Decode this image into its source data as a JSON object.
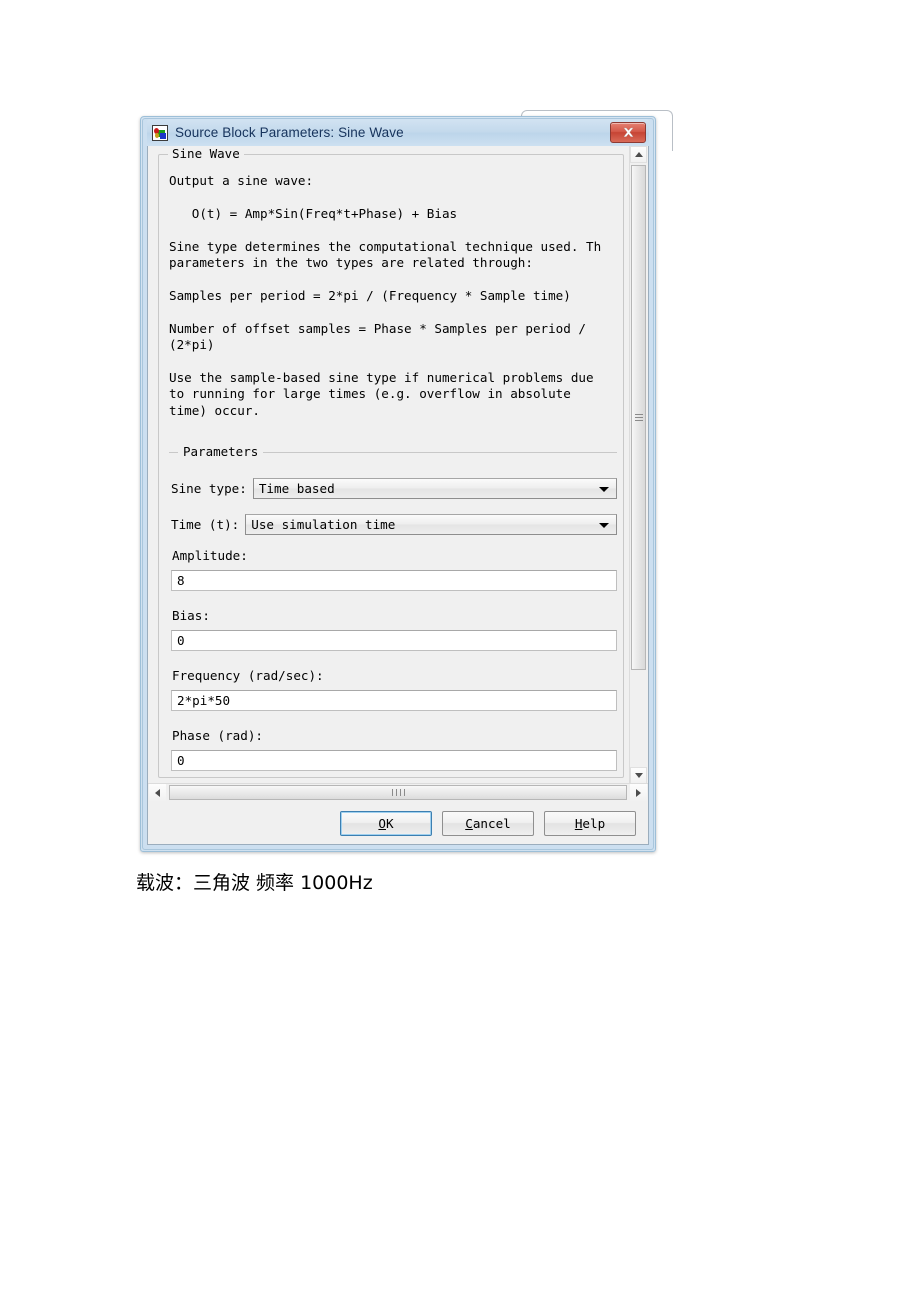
{
  "dialog": {
    "title": "Source Block Parameters: Sine Wave",
    "title_icon": "simulink-block-icon",
    "close_icon": "close-icon",
    "group_title": "Sine Wave",
    "description": "Output a sine wave:\n\n   O(t) = Amp*Sin(Freq*t+Phase) + Bias\n\nSine type determines the computational technique used. Th\nparameters in the two types are related through:\n\nSamples per period = 2*pi / (Frequency * Sample time)\n\nNumber of offset samples = Phase * Samples per period /\n(2*pi)\n\nUse the sample-based sine type if numerical problems due\nto running for large times (e.g. overflow in absolute\ntime) occur.",
    "parameters_title": "Parameters",
    "fields": {
      "sine_type_label": "Sine type:",
      "sine_type_value": "Time based",
      "time_label": "Time (t):",
      "time_value": "Use simulation time",
      "amplitude_label": "Amplitude:",
      "amplitude_value": "8",
      "bias_label": "Bias:",
      "bias_value": "0",
      "frequency_label": "Frequency (rad/sec):",
      "frequency_value": "2*pi*50",
      "phase_label": "Phase (rad):",
      "phase_value": "0"
    },
    "buttons": {
      "ok_pre": "",
      "ok_mnemonic": "O",
      "ok_post": "K",
      "cancel_pre": "",
      "cancel_mnemonic": "C",
      "cancel_post": "ancel",
      "help_pre": "",
      "help_mnemonic": "H",
      "help_post": "elp"
    },
    "scrollbars": {
      "v_up_icon": "scroll-up-arrow-icon",
      "v_down_icon": "scroll-down-arrow-icon",
      "h_left_icon": "scroll-left-arrow-icon",
      "h_right_icon": "scroll-right-arrow-icon"
    }
  },
  "caption": "载波：三角波 频率 1000Hz",
  "colors": {
    "title_bar_blue": "#c3d9ec",
    "close_red": "#c64434",
    "default_button_focus": "#3c7fb1",
    "client_gray": "#f0f0f0"
  }
}
